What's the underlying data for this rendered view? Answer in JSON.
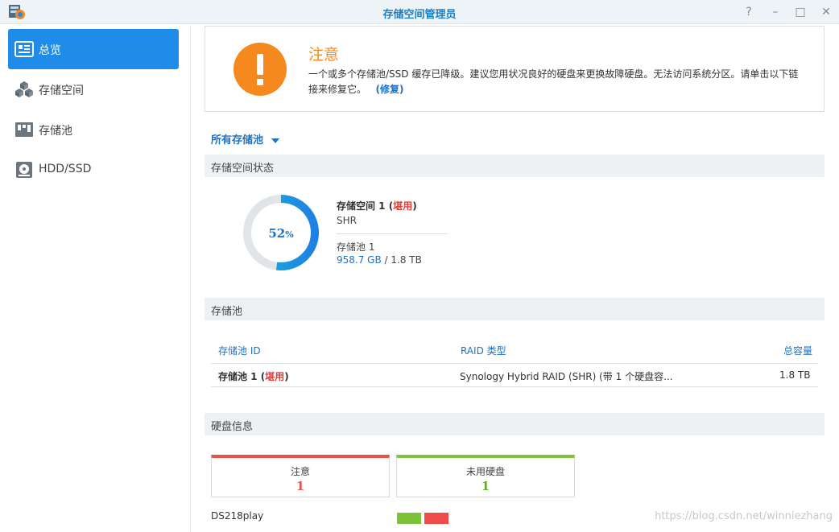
{
  "window": {
    "title": "存储空间管理员",
    "controls": [
      "?",
      "–",
      "□",
      "✕"
    ]
  },
  "sidebar": {
    "items": [
      {
        "label": "总览",
        "icon": "overview-icon",
        "active": true
      },
      {
        "label": "存储空间",
        "icon": "cubes-icon",
        "active": false
      },
      {
        "label": "存储池",
        "icon": "storage-pool-icon",
        "active": false
      },
      {
        "label": "HDD/SSD",
        "icon": "hdd-icon",
        "active": false
      }
    ]
  },
  "alert": {
    "icon": "exclamation-icon",
    "title": "注意",
    "message": "一个或多个存储池/SSD 缓存已降级。建议您用状况良好的硬盘来更换故障硬盘。无法访问系统分区。请单击以下链接来修复它。",
    "link_label": "(修复)"
  },
  "pool_filter": {
    "label": "所有存储池"
  },
  "volume_status": {
    "section_title": "存储空间状态",
    "usage_percent": 52,
    "usage_label": "52",
    "usage_unit": "%",
    "volume_name": "存储空间 1",
    "volume_status_open": " (",
    "volume_status": "堪用",
    "volume_status_close": ")",
    "raid_type": "SHR",
    "pool_name": "存储池 1",
    "used": "958.7 GB",
    "separator": " / ",
    "total": "1.8 TB"
  },
  "storage_pool": {
    "section_title": "存储池",
    "columns": [
      "存储池 ID",
      "RAID 类型",
      "总容量"
    ],
    "rows": [
      {
        "id": "存储池 1",
        "status_open": " (",
        "status": "堪用",
        "status_close": ")",
        "raid": "Synology Hybrid RAID (SHR) (带 1 个硬盘容...",
        "capacity": "1.8 TB"
      }
    ]
  },
  "disk_info": {
    "section_title": "硬盘信息",
    "cards": [
      {
        "label": "注意",
        "count": "1",
        "color": "#e8514c"
      },
      {
        "label": "未用硬盘",
        "count": "1",
        "color": "#7cc23a"
      }
    ],
    "device_name": "DS218play",
    "slots": [
      {
        "state": "unused",
        "color": "#7cc23a"
      },
      {
        "state": "warning",
        "color": "#f04b4b"
      }
    ]
  },
  "watermark": "https://blog.csdn.net/winniezhang",
  "colors": {
    "accent": "#1e8ce8",
    "warning_orange": "#f5891f",
    "link_blue": "#1a73c7",
    "donut_track": "#e2e5e8"
  }
}
